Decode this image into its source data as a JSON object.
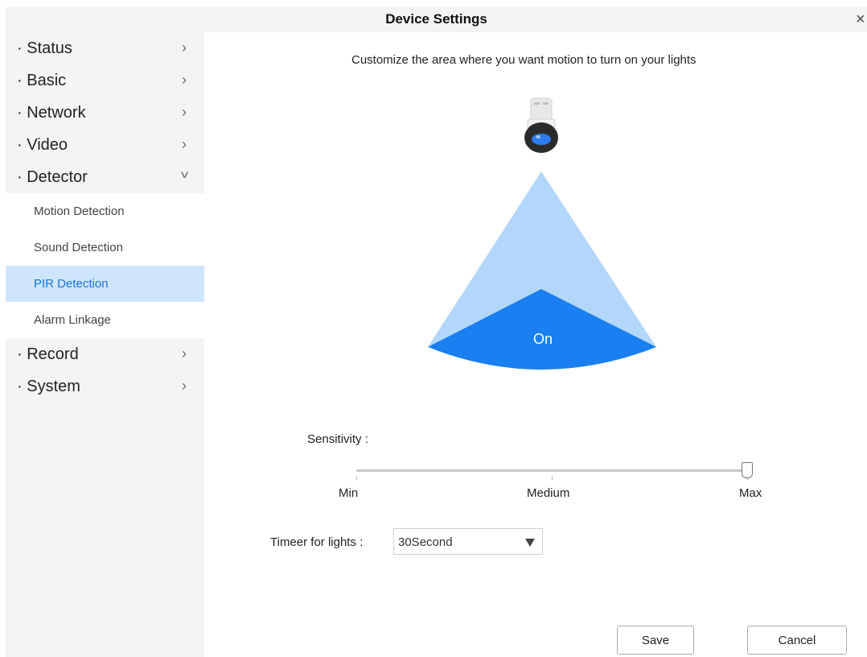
{
  "window": {
    "title": "Device Settings",
    "close_glyph": "×"
  },
  "sidebar": {
    "prefix": "·",
    "items": [
      {
        "label": "Status",
        "chevron": "›"
      },
      {
        "label": "Basic",
        "chevron": "›"
      },
      {
        "label": "Network",
        "chevron": "›"
      },
      {
        "label": "Video",
        "chevron": "›"
      },
      {
        "label": "Detector",
        "chevron": "v"
      },
      {
        "label": "Record",
        "chevron": "›"
      },
      {
        "label": "System",
        "chevron": "›"
      }
    ],
    "detector_submenu": [
      {
        "label": "Motion Detection",
        "active": false
      },
      {
        "label": "Sound Detection",
        "active": false
      },
      {
        "label": "PIR Detection",
        "active": true
      },
      {
        "label": "Alarm Linkage",
        "active": false
      }
    ]
  },
  "main": {
    "hint": "Customize the area where you want motion to turn on your lights",
    "zone": {
      "label": "On",
      "icon": "camera-icon"
    },
    "sensitivity": {
      "label": "Sensitivity :",
      "min_label": "Min",
      "mid_label": "Medium",
      "max_label": "Max",
      "level": "Max"
    },
    "timer": {
      "label": "Timeer for lights :",
      "value": "30Second"
    },
    "buttons": {
      "save": "Save",
      "cancel": "Cancel"
    }
  },
  "colors": {
    "sidebar_bg": "#f4f4f4",
    "active_bg": "#cfe5fd",
    "active_text": "#1a73d9",
    "zone_light": "#b3d6fb",
    "zone_dark": "#1a7ff0"
  }
}
